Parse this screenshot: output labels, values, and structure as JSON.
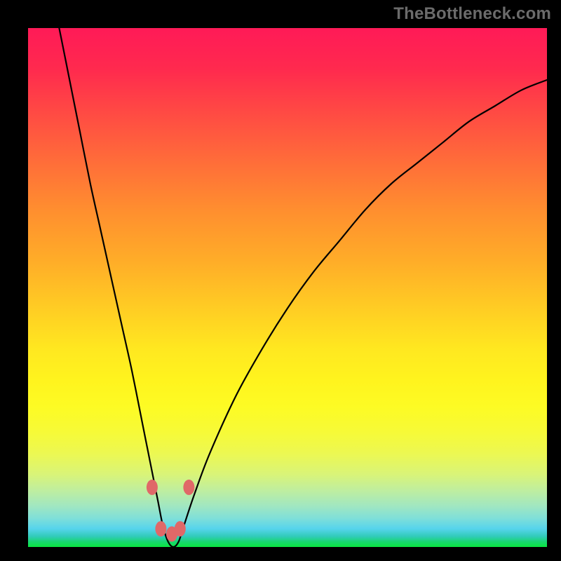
{
  "watermark": "TheBottleneck.com",
  "colors": {
    "frame": "#000000",
    "curve": "#000000",
    "marker": "#e06868",
    "gradient_top": "#ff1a57",
    "gradient_bottom": "#0ae641"
  },
  "chart_data": {
    "type": "line",
    "title": "",
    "xlabel": "",
    "ylabel": "",
    "xlim": [
      0,
      100
    ],
    "ylim": [
      0,
      100
    ],
    "grid": false,
    "legend": false,
    "notes": "V-shaped bottleneck curve; minimum band near x≈26–29 where y≈0. Color gradient encodes value red(high)→green(low).",
    "series": [
      {
        "name": "curve",
        "x": [
          6,
          8,
          10,
          12,
          14,
          16,
          18,
          20,
          22,
          23,
          24,
          25,
          26,
          27,
          28,
          29,
          30,
          32,
          35,
          40,
          45,
          50,
          55,
          60,
          65,
          70,
          75,
          80,
          85,
          90,
          95,
          100
        ],
        "y": [
          100,
          90,
          80,
          70,
          61,
          52,
          43,
          34,
          24,
          19,
          14,
          9,
          4,
          1,
          0,
          1,
          4,
          10,
          18,
          29,
          38,
          46,
          53,
          59,
          65,
          70,
          74,
          78,
          82,
          85,
          88,
          90
        ]
      }
    ],
    "markers": [
      {
        "x": 23.9,
        "y": 11.5
      },
      {
        "x": 25.6,
        "y": 3.5
      },
      {
        "x": 27.7,
        "y": 2.5
      },
      {
        "x": 29.3,
        "y": 3.5
      },
      {
        "x": 31.0,
        "y": 11.5
      }
    ]
  }
}
